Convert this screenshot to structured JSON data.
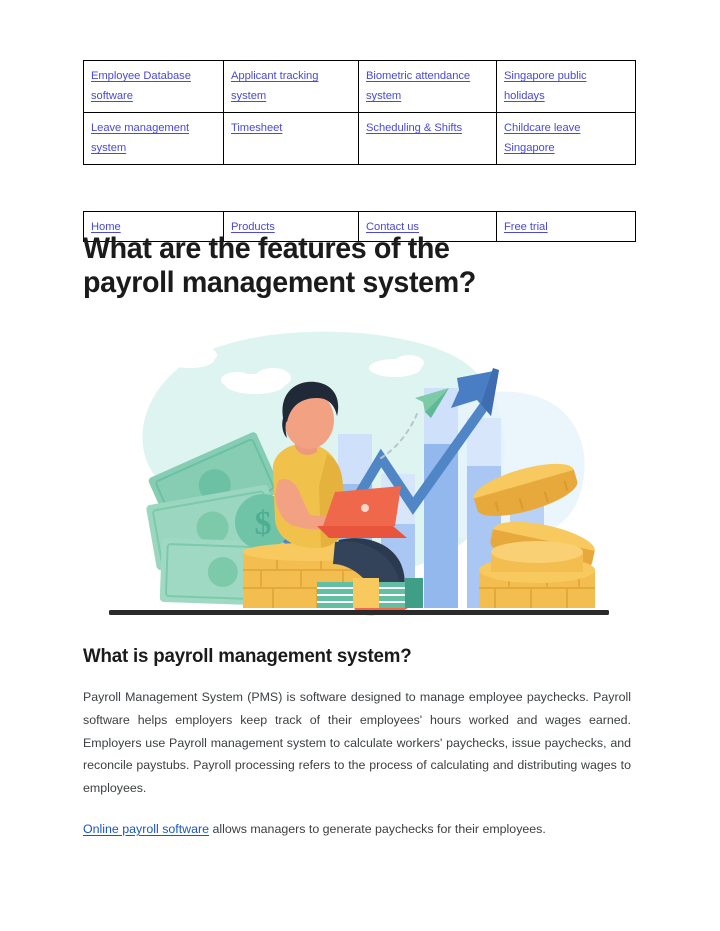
{
  "nav_primary": {
    "name": "feature-links-table",
    "rows": [
      [
        {
          "label": "Employee Database software"
        },
        {
          "label": "Applicant tracking system"
        },
        {
          "label": "Biometric attendance system"
        },
        {
          "label": "Singapore public holidays"
        }
      ],
      [
        {
          "label": "Leave management system"
        },
        {
          "label": "Timesheet"
        },
        {
          "label": "Scheduling & Shifts"
        },
        {
          "label": "Childcare leave Singapore"
        }
      ]
    ]
  },
  "nav_secondary": {
    "name": "site-nav-table",
    "rows": [
      [
        {
          "label": "Home"
        },
        {
          "label": "Products"
        },
        {
          "label": "Contact us"
        },
        {
          "label": "Free trial"
        }
      ]
    ]
  },
  "page_title": "What are the features of the payroll management system?",
  "section": {
    "heading": "What is payroll management system?",
    "paragraph_1": "Payroll Management System (PMS) is software designed to manage employee paychecks. Payroll software helps employers keep track of their employees' hours worked and wages earned. Employers use Payroll management system to calculate workers' paychecks, issue paychecks, and reconcile paystubs. Payroll processing refers to the process of calculating and distributing wages to employees.",
    "paragraph_2_link": "Online payroll software",
    "paragraph_2_rest": " allows managers to generate paychecks for their employees."
  },
  "illustration": {
    "alt": "Person with laptop sitting on stack of gold coins in front of a rising bar chart with an upward trending arrow, banknotes and coins",
    "colors": {
      "blob_mint": "#dcf4f0",
      "bar_light": "#cfe0fa",
      "bar_mid": "#a8c6f2",
      "bar_dark": "#8fb6ee",
      "arrow_blue": "#4a7ec4",
      "coin_gold": "#f3bd4f",
      "coin_gold_dark": "#e8a93c",
      "money_green": "#6bc2a6",
      "money_green_dark": "#3f9e86",
      "shirt_yellow": "#f0c14b",
      "skin": "#f2a183",
      "hair_dark": "#1f2937",
      "pants_navy": "#2b3a4f",
      "laptop_red": "#f0684b",
      "shoe_coral": "#f4674b",
      "ground_dark": "#2b2b2b",
      "plane_green": "#7ccaa6"
    }
  },
  "link_colors": {
    "table_link": "#4a4ad4",
    "body_link": "#1a56c4"
  }
}
